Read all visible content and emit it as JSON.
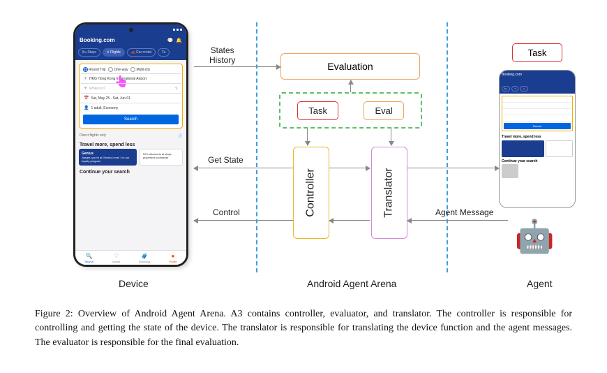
{
  "device": {
    "app_title": "Booking.com",
    "tabs": [
      "Stays",
      "Flights",
      "Car rental",
      "Ta"
    ],
    "trip_options": [
      "Round Trip",
      "One-way",
      "Multi-city"
    ],
    "from_field": "HKG Hong Kong International Airport",
    "to_placeholder": "Where to?",
    "dates": "Sat, May 25 - Sat, Jun 01",
    "pax": "1 adult, Economy",
    "search_label": "Search",
    "direct_label": "Direct flights only",
    "promo_heading": "Travel more, spend less",
    "genius_title": "Genius",
    "genius_text": "Jaeger, you're at Genius Level 1 in our loyalty program",
    "discount_text": "10% discounts at stays properties worldwide",
    "continue_heading": "Continue your search",
    "nav": [
      "Search",
      "Saved",
      "Bookings",
      "Profile"
    ]
  },
  "arrows": {
    "states_history": "States\nHistory",
    "get_state": "Get State",
    "control": "Control",
    "agent_message": "Agent Message"
  },
  "arena": {
    "evaluation": "Evaluation",
    "task": "Task",
    "eval": "Eval",
    "controller": "Controller",
    "translator": "Translator"
  },
  "agent": {
    "task_label": "Task"
  },
  "section_labels": {
    "device": "Device",
    "arena": "Android Agent Arena",
    "agent": "Agent"
  },
  "caption": "Figure 2: Overview of Android Agent Arena. A3 contains controller, evaluator, and translator. The controller is responsible for controlling and getting the state of the device. The translator is responsible for translating the device function and the agent messages. The evaluator is responsible for the final evaluation."
}
